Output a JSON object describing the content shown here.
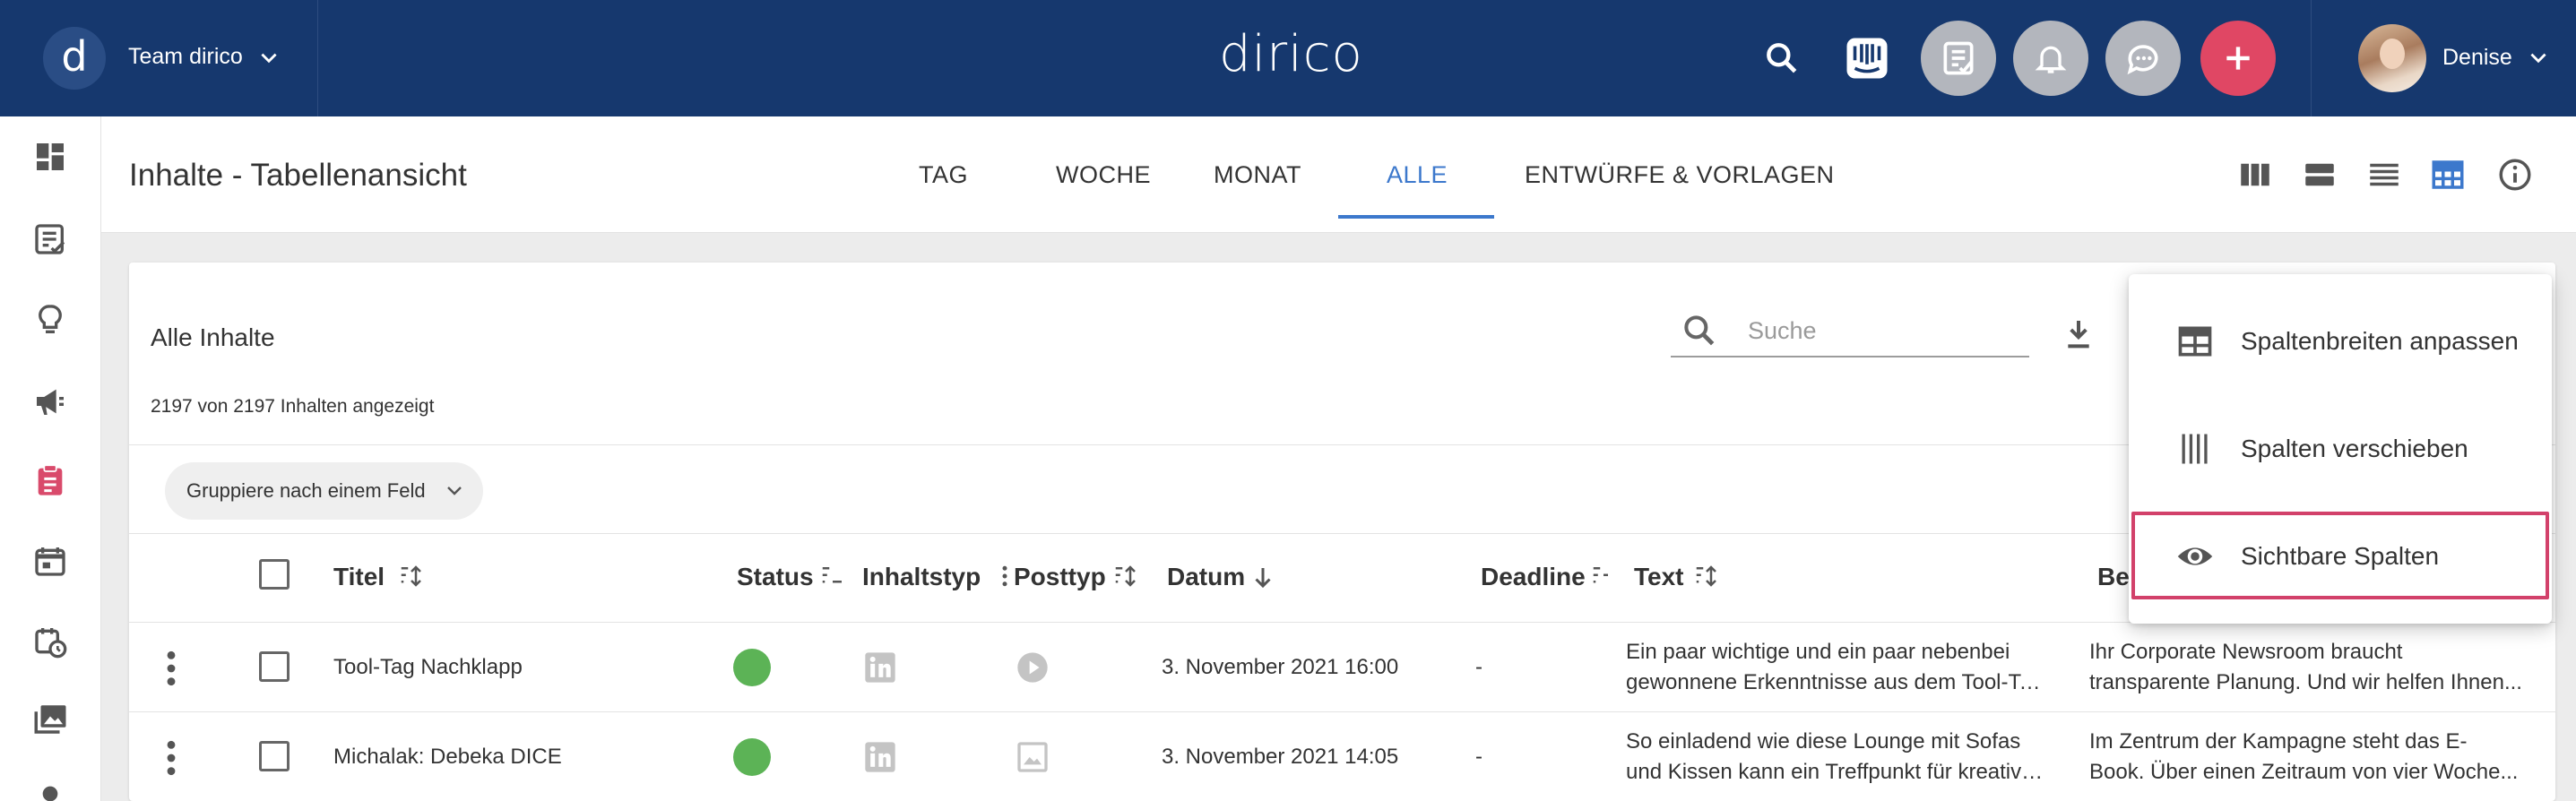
{
  "topbar": {
    "team_logo_letter": "d",
    "team_name": "Team dirico",
    "brand": "dirico",
    "user_name": "Denise",
    "icons": [
      "search-icon",
      "intercom-icon",
      "tasks-icon",
      "bell-icon",
      "chat-icon",
      "plus-icon"
    ],
    "colors": {
      "bar": "#16386e",
      "accent_red": "#e04764",
      "gray_circle": "#b3b6bd"
    }
  },
  "sidebar": {
    "icons": [
      "dashboard-icon",
      "content-list-icon",
      "idea-icon",
      "campaign-icon",
      "clipboard-icon",
      "calendar-icon",
      "schedule-icon",
      "media-icon",
      "pin-icon"
    ]
  },
  "header": {
    "title": "Inhalte - Tabellenansicht",
    "tabs": [
      {
        "label": "TAG",
        "active": false
      },
      {
        "label": "WOCHE",
        "active": false
      },
      {
        "label": "MONAT",
        "active": false
      },
      {
        "label": "ALLE",
        "active": true
      },
      {
        "label": "ENTWÜRFE & VORLAGEN",
        "active": false
      }
    ],
    "view_icons": [
      "columns-view-icon",
      "cards-view-icon",
      "list-view-icon",
      "table-view-icon",
      "info-icon"
    ],
    "active_view": "table-view-icon",
    "accent": "#3c78cc"
  },
  "card": {
    "title": "Alle Inhalte",
    "count_text": "2197 von 2197 Inhalten angezeigt",
    "search_placeholder": "Suche",
    "group_label": "Gruppiere nach einem Feld"
  },
  "table": {
    "columns": [
      "Titel",
      "Status",
      "Inhaltstyp",
      "Posttyp",
      "Datum",
      "Deadline",
      "Text",
      "Be"
    ],
    "rows": [
      {
        "title": "Tool-Tag Nachklapp",
        "status": "green",
        "content_type": "linkedin",
        "post_type": "video",
        "date": "3. November 2021 16:00",
        "deadline": "-",
        "text_line1": "Ein paar wichtige und ein paar nebenbei",
        "text_line2": "gewonnene Erkenntnisse aus dem Tool-Ta...",
        "desc_line1": "Ihr Corporate Newsroom braucht",
        "desc_line2": "transparente Planung. Und wir helfen Ihnen..."
      },
      {
        "title": "Michalak: Debeka DICE",
        "status": "green",
        "content_type": "linkedin",
        "post_type": "image",
        "date": "3. November 2021 14:05",
        "deadline": "-",
        "text_line1": "So einladend wie diese Lounge mit Sofas",
        "text_line2": "und Kissen kann ein Treffpunkt für kreative...",
        "desc_line1": "Im Zentrum der Kampagne steht das E-",
        "desc_line2": "Book. Über einen Zeitraum von vier Woche..."
      }
    ]
  },
  "menu": {
    "items": [
      {
        "label": "Spaltenbreiten anpassen",
        "icon": "table-columns-icon"
      },
      {
        "label": "Spalten verschieben",
        "icon": "column-bars-icon"
      },
      {
        "label": "Sichtbare Spalten",
        "icon": "eye-icon",
        "highlighted": true
      }
    ],
    "highlight_color": "#d2416a"
  }
}
